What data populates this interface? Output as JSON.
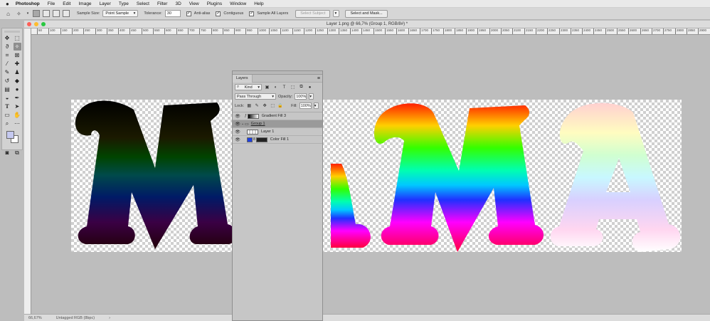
{
  "menubar": {
    "apple": "",
    "items": [
      "Photoshop",
      "File",
      "Edit",
      "Image",
      "Layer",
      "Type",
      "Select",
      "Filter",
      "3D",
      "View",
      "Plugins",
      "Window",
      "Help"
    ]
  },
  "options": {
    "sample_size_label": "Sample Size:",
    "sample_size_value": "Point Sample",
    "tolerance_label": "Tolerance:",
    "tolerance_value": "30",
    "anti_alias_label": "Anti-alias",
    "contiguous_label": "Contiguous",
    "sample_all_label": "Sample All Layers",
    "select_subject_label": "Select Subject",
    "select_mask_label": "Select and Mask..."
  },
  "document": {
    "title": "Layer 1.png @ 66,7% (Group 1, RGB/8#) *",
    "zoom": "66,67%",
    "profile": "Untagged RGB (8bpc)",
    "ruler_ticks": [
      "50",
      "100",
      "150",
      "200",
      "250",
      "300",
      "350",
      "400",
      "450",
      "500",
      "550",
      "600",
      "650",
      "700",
      "750",
      "800",
      "850",
      "900",
      "950",
      "1000",
      "1050",
      "1100",
      "1150",
      "1200",
      "1250",
      "1300",
      "1350",
      "1400",
      "1450",
      "1500",
      "1550",
      "1600",
      "1650",
      "1700",
      "1750",
      "1800",
      "1850",
      "1900",
      "1950",
      "2000",
      "2050",
      "2100",
      "2150",
      "2200",
      "2250",
      "2300",
      "2350",
      "2400",
      "2450",
      "2500",
      "2550",
      "2600",
      "2650",
      "2700",
      "2750",
      "2800",
      "2850",
      "2900"
    ]
  },
  "layers_panel": {
    "tab": "Layers",
    "filter_kind": "Kind",
    "blend_mode": "Pass Through",
    "opacity_label": "Opacity:",
    "opacity_value": "100%",
    "lock_label": "Lock:",
    "fill_label": "Fill:",
    "fill_value": "100%",
    "layers": [
      {
        "name": "Gradient Fill 3",
        "indent": false,
        "type": "gradient"
      },
      {
        "name": "Group 1",
        "indent": false,
        "type": "group",
        "selected": true
      },
      {
        "name": "Layer 1",
        "indent": true,
        "type": "pixel"
      },
      {
        "name": "Color Fill 1",
        "indent": true,
        "type": "fill"
      }
    ]
  },
  "colors": {
    "fg_swatch": "#c5c9f0",
    "bg_swatch": "#ffffff",
    "color_fill": "#1d3fe0"
  }
}
